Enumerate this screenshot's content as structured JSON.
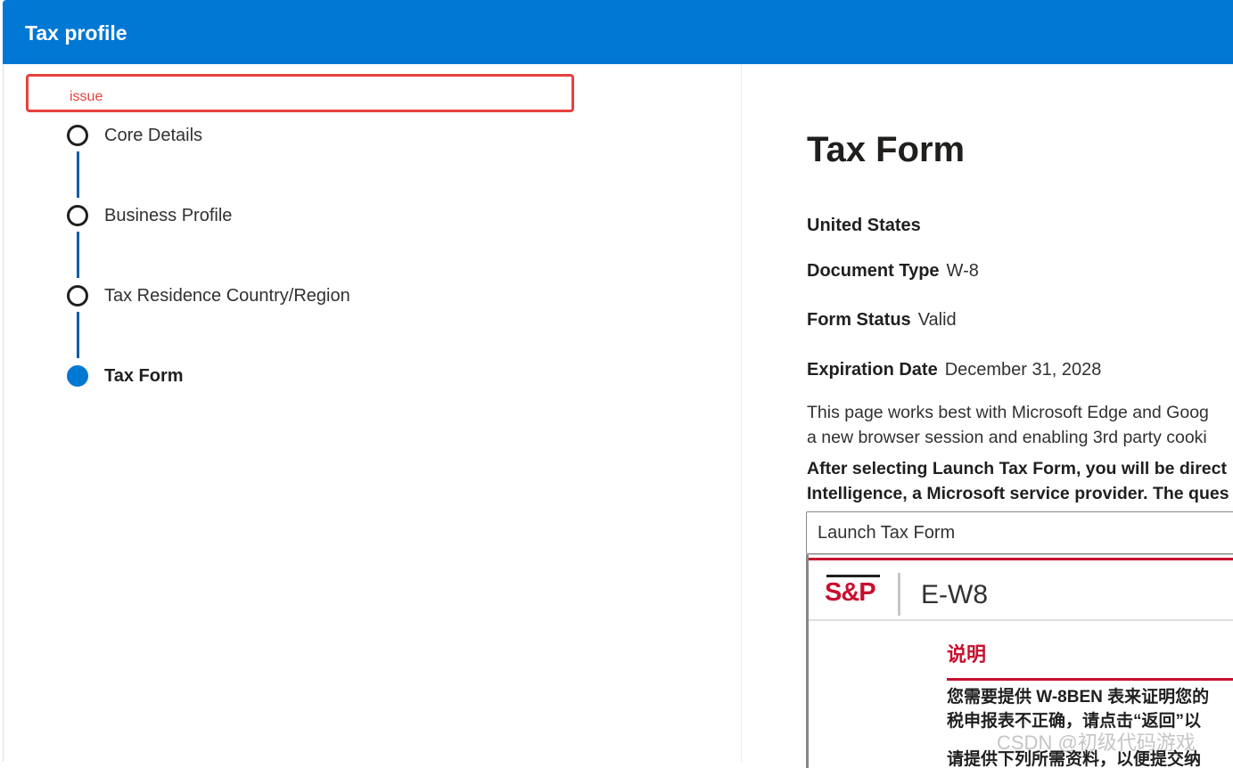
{
  "header": {
    "title": "Tax profile"
  },
  "issue": {
    "label": "issue"
  },
  "steps": [
    {
      "label": "Core Details",
      "state": "incomplete"
    },
    {
      "label": "Business Profile",
      "state": "incomplete"
    },
    {
      "label": "Tax Residence Country/Region",
      "state": "incomplete"
    },
    {
      "label": "Tax Form",
      "state": "active"
    }
  ],
  "main": {
    "title": "Tax Form",
    "country": "United States",
    "document_type": {
      "label": "Document Type",
      "value": "W-8"
    },
    "form_status": {
      "label": "Form Status",
      "value": "Valid"
    },
    "expiration_date": {
      "label": "Expiration Date",
      "value": "December 31, 2028"
    },
    "info_line1": "This page works best with Microsoft Edge and Goog",
    "info_line2": "a new browser session and enabling 3rd party cooki",
    "notice_line1": "After selecting Launch Tax Form, you will be direct",
    "notice_line2": "Intelligence, a Microsoft service provider. The ques",
    "launch_button": "Launch Tax Form"
  },
  "embedded_form": {
    "logo": "S&P",
    "form_name": "E-W8",
    "heading": "说明",
    "text_line1": "您需要提供 W-8BEN 表来证明您的",
    "text_line2": "税申报表不正确，请点击“返回”以",
    "text_line3": "请提供下列所需资料，以便提交纳"
  },
  "watermark": "CSDN @初级代码游戏",
  "colors": {
    "header": "#0078d4",
    "issue": "#e8413e",
    "brand": "#c8102e",
    "connector": "#0f5ea3"
  }
}
